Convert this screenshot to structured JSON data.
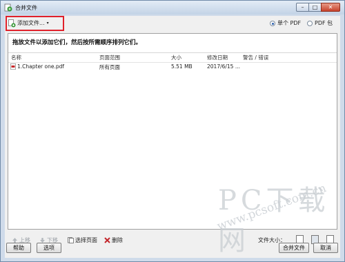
{
  "window": {
    "title": "合并文件",
    "controls": {
      "minimize": "–",
      "maximize": "□",
      "close": "✕"
    }
  },
  "toolbar": {
    "add_files_label": "添加文件...",
    "add_files_arrow": "▾",
    "output_options": [
      {
        "label": "单个 PDF",
        "checked": true
      },
      {
        "label": "PDF 包",
        "checked": false
      }
    ]
  },
  "drop_area": {
    "hint": "拖放文件以添加它们，然后按所需顺序排列它们。",
    "columns": [
      "名称",
      "页面范围",
      "大小",
      "修改日期",
      "警告 / 错误"
    ],
    "rows": [
      {
        "name": "1.Chapter one.pdf",
        "page_range": "所有页面",
        "size": "5.51 MB",
        "modified": "2017/6/15 ...",
        "warnings": ""
      }
    ]
  },
  "bottom_bar": {
    "move_up": "上移",
    "move_down": "下移",
    "choose_pages": "选择页面",
    "delete": "删除",
    "file_size_label": "文件大小："
  },
  "footer": {
    "help": "帮助",
    "options": "选项",
    "combine": "合并文件",
    "cancel": "取消"
  },
  "watermark": {
    "big": "PC下载网",
    "url": "www.pcsoft.com.cn"
  },
  "colors": {
    "highlight_box": "#e0202a",
    "window_frame": "#cfdbea"
  }
}
